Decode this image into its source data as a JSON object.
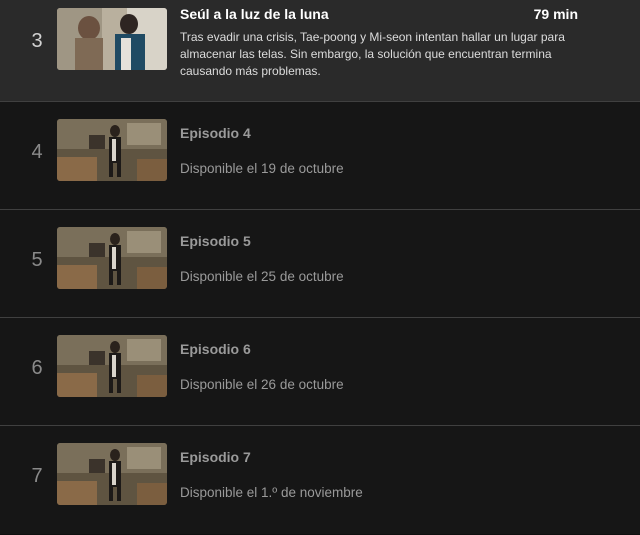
{
  "episodes": [
    {
      "number": "3",
      "title": "Seúl a la luz de la luna",
      "duration": "79 min",
      "synopsis": "Tras evadir una crisis, Tae-poong y Mi-seon intentan hallar un lugar para almacenar las telas. Sin embargo, la solución que encuentran termina causando más problemas."
    },
    {
      "number": "4",
      "title": "Episodio 4",
      "availability": "Disponible el 19 de octubre"
    },
    {
      "number": "5",
      "title": "Episodio 5",
      "availability": "Disponible el 25 de octubre"
    },
    {
      "number": "6",
      "title": "Episodio 6",
      "availability": "Disponible el 26 de octubre"
    },
    {
      "number": "7",
      "title": "Episodio 7",
      "availability": "Disponible el 1.º de noviembre"
    }
  ],
  "colors": {
    "background": "#0f0f0f",
    "active_row": "#2a2a2a",
    "pending_row": "#161616",
    "muted_text": "#9a9a9a"
  }
}
